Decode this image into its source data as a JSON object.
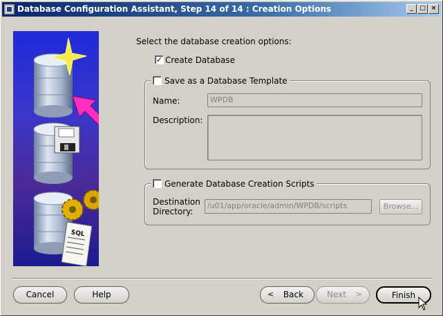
{
  "window": {
    "title": "Database Configuration Assistant, Step 14 of 14 : Creation Options",
    "controls": {
      "minimize": "_",
      "maximize": "□",
      "close": "×"
    }
  },
  "main": {
    "prompt": "Select the database creation options:",
    "create_database": {
      "label": "Create Database",
      "checked": true
    },
    "template_group": {
      "label": "Save as a Database Template",
      "checked": false,
      "name_label": "Name:",
      "name_value": "WPDB",
      "description_label": "Description:",
      "description_value": ""
    },
    "scripts_group": {
      "label": "Generate Database Creation Scripts",
      "checked": false,
      "destination_label_line1": "Destination",
      "destination_label_line2": "Directory:",
      "destination_value": "/u01/app/oracle/admin/WPDB/scripts",
      "browse_label": "Browse..."
    }
  },
  "side_image": {
    "sql_label": "SQL"
  },
  "footer": {
    "cancel": "Cancel",
    "help": "Help",
    "back": "Back",
    "next": "Next",
    "finish": "Finish"
  }
}
